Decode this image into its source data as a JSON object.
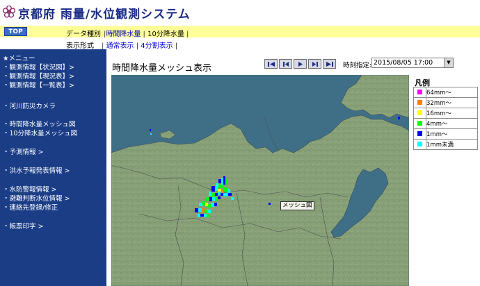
{
  "header": {
    "title": "京都府 雨量/水位観測システム",
    "logo_icon": "flower-crest-icon"
  },
  "top_row": {
    "top_button": "TOP",
    "data_type_label": "データ種別",
    "options": [
      "時間降水量",
      "10分降水量"
    ],
    "selected_option": "時間降水量"
  },
  "mode_row": {
    "label": "表示形式",
    "options": [
      "通常表示",
      "4分割表示"
    ]
  },
  "sidebar": {
    "menu_heading": "★メニュー",
    "items": [
      "・観測情報【状況図】>",
      "・観測情報【現況表】>",
      "・観測情報【一覧表】>",
      "・河川防災カメラ",
      "・時間降水量メッシュ図",
      "・10分降水量メッシュ図",
      "・予測情報 >",
      "・洪水予報発表情報 >",
      "・水防警報情報 >",
      "・避難判断水位情報 >",
      "・連絡先登録/修正",
      "・帳票印字 >"
    ]
  },
  "main": {
    "title": "時間降水量メッシュ表示",
    "time_label": "時刻指定:",
    "time_value": "2015/08/05 17:00",
    "player_icons": [
      "first-frame-icon",
      "previous-frame-icon",
      "play-icon",
      "next-frame-icon",
      "last-frame-icon"
    ],
    "map_label": "メッシュ図"
  },
  "legend": {
    "title": "凡例",
    "items": [
      {
        "label": "64mm～",
        "color": "#ff00ff"
      },
      {
        "label": "32mm～",
        "color": "#ff8000"
      },
      {
        "label": "16mm～",
        "color": "#ffff00"
      },
      {
        "label": "4mm～",
        "color": "#00ff00"
      },
      {
        "label": "1mm～",
        "color": "#0000ff"
      },
      {
        "label": "1mm未満",
        "color": "#00ffff"
      }
    ]
  },
  "colors": {
    "sidebar_bg": "#1a3d86",
    "header_strip": "#ffff99",
    "title_blue": "#1a2c86",
    "sea": "#3f6f86",
    "land": "#8aa27a"
  }
}
